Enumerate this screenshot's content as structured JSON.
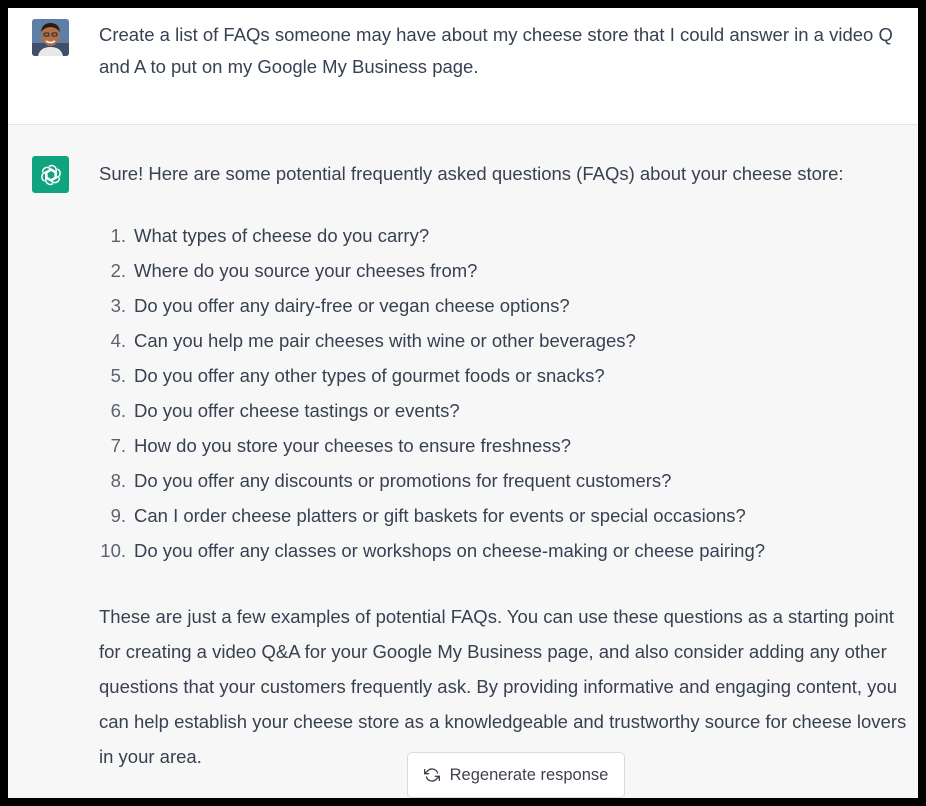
{
  "conversation": {
    "user_message": {
      "avatar_icon": "user-avatar-photo",
      "text": "Create a list of FAQs someone may have about my cheese store that I could answer in a video Q and A to put on my Google My Business page."
    },
    "assistant_message": {
      "avatar_icon": "openai-logo-icon",
      "avatar_color": "#10a37f",
      "intro": "Sure! Here are some potential frequently asked questions (FAQs) about your cheese store:",
      "faqs": [
        {
          "num": "1.",
          "text": "What types of cheese do you carry?"
        },
        {
          "num": "2.",
          "text": "Where do you source your cheeses from?"
        },
        {
          "num": "3.",
          "text": "Do you offer any dairy-free or vegan cheese options?"
        },
        {
          "num": "4.",
          "text": "Can you help me pair cheeses with wine or other beverages?"
        },
        {
          "num": "5.",
          "text": "Do you offer any other types of gourmet foods or snacks?"
        },
        {
          "num": "6.",
          "text": "Do you offer cheese tastings or events?"
        },
        {
          "num": "7.",
          "text": "How do you store your cheeses to ensure freshness?"
        },
        {
          "num": "8.",
          "text": "Do you offer any discounts or promotions for frequent customers?"
        },
        {
          "num": "9.",
          "text": "Can I order cheese platters or gift baskets for events or special occasions?"
        },
        {
          "num": "10.",
          "text": "Do you offer any classes or workshops on cheese-making or cheese pairing?"
        }
      ],
      "outro": "These are just a few examples of potential FAQs. You can use these questions as a starting point for creating a video Q&A for your Google My Business page, and also consider adding any other questions that your customers frequently ask. By providing informative and engaging content, you can help establish your cheese store as a knowledgeable and trustworthy source for cheese lovers in your area."
    }
  },
  "regenerate_button": {
    "label": "Regenerate response",
    "icon": "refresh-icon"
  },
  "colors": {
    "user_bg": "#ffffff",
    "assistant_bg": "#f7f7f8",
    "text": "#374151",
    "brand": "#10a37f"
  }
}
